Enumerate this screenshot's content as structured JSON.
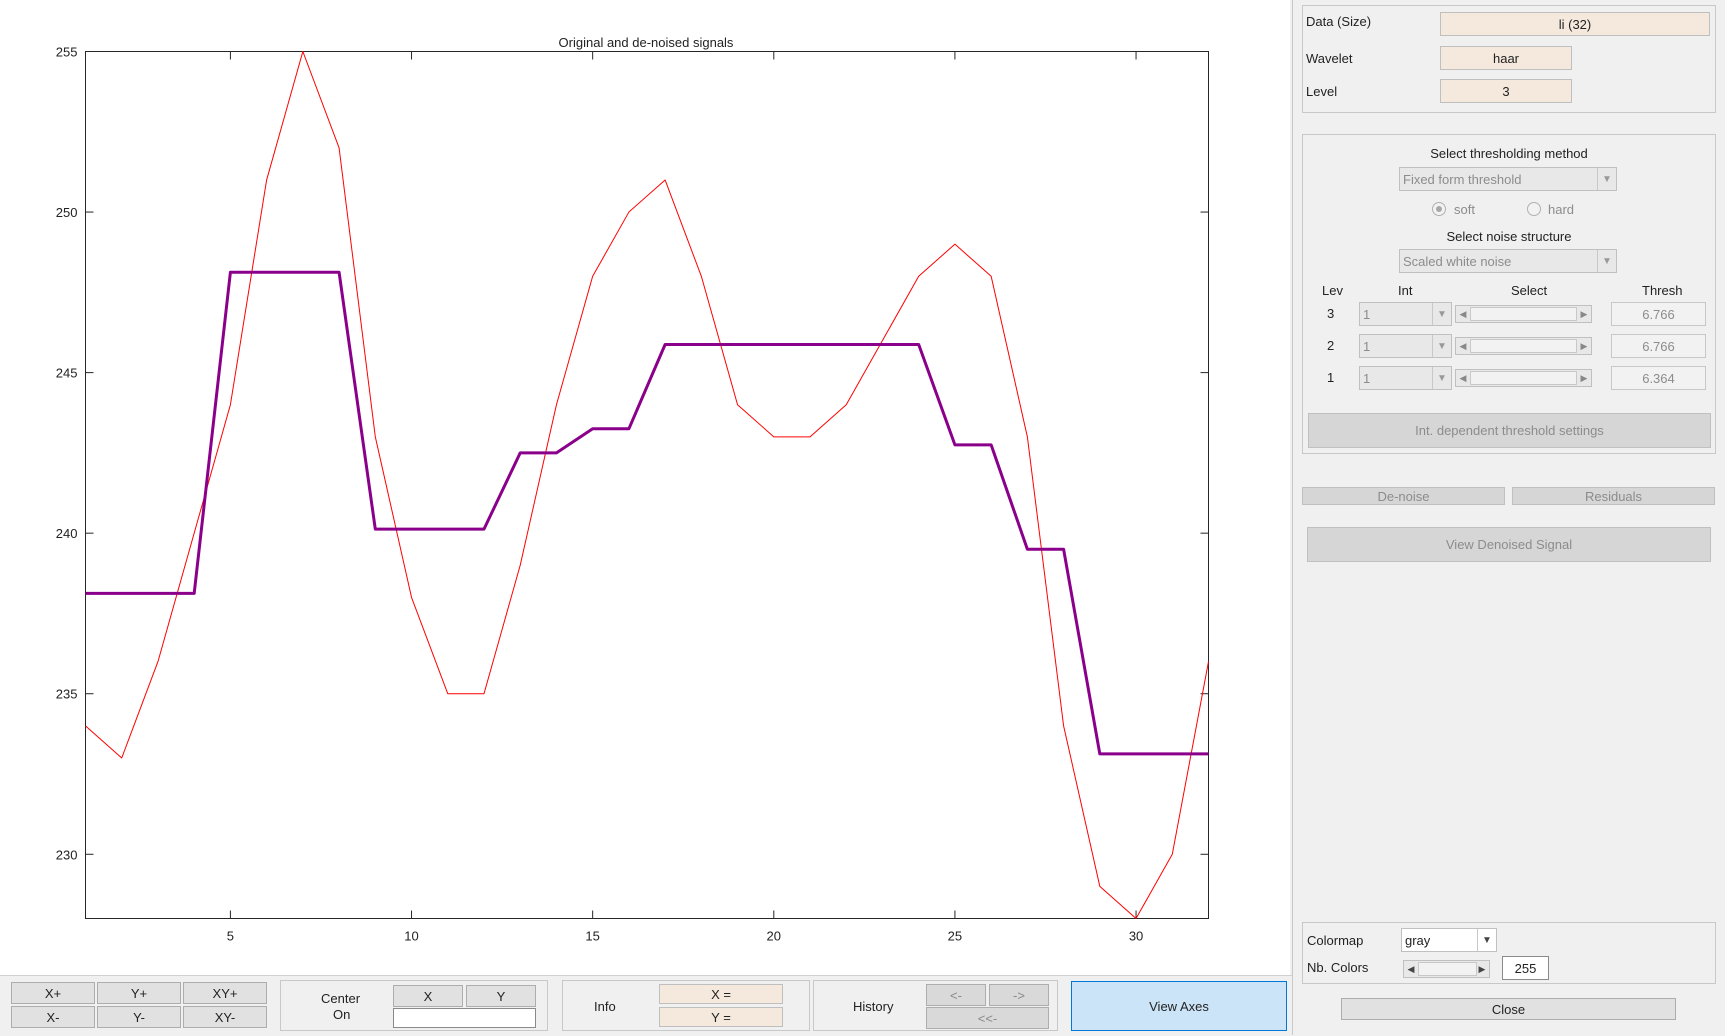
{
  "chart_data": {
    "type": "line",
    "title": "Original and de-noised signals",
    "xlabel": "",
    "ylabel": "",
    "xlim": [
      1,
      32
    ],
    "ylim": [
      228,
      255
    ],
    "x_ticks": [
      5,
      10,
      15,
      20,
      25,
      30
    ],
    "y_ticks": [
      230,
      235,
      240,
      245,
      250,
      255
    ],
    "grid": false,
    "legend": "none",
    "x": [
      1,
      2,
      3,
      4,
      5,
      6,
      7,
      8,
      9,
      10,
      11,
      12,
      13,
      14,
      15,
      16,
      17,
      18,
      19,
      20,
      21,
      22,
      23,
      24,
      25,
      26,
      27,
      28,
      29,
      30,
      31,
      32
    ],
    "series": [
      {
        "color": "#ff0000",
        "width": 1,
        "values": [
          234,
          233,
          236,
          240,
          244,
          251,
          255,
          252,
          243,
          238,
          235,
          235,
          239,
          244,
          248,
          250,
          251,
          248,
          244,
          243,
          243,
          244,
          246,
          248,
          249,
          248,
          243,
          234,
          229,
          228,
          230,
          236
        ]
      },
      {
        "color": "#8b008b",
        "width": 3,
        "step": true,
        "values": [
          238.125,
          238.125,
          238.125,
          238.125,
          248.125,
          248.125,
          248.125,
          248.125,
          240.125,
          240.125,
          240.125,
          240.125,
          242.5,
          242.5,
          243.25,
          243.25,
          245.875,
          245.875,
          245.875,
          245.875,
          245.875,
          245.875,
          245.875,
          245.875,
          242.75,
          242.75,
          239.5,
          239.5,
          233.125,
          233.125,
          233.125,
          233.125
        ]
      }
    ]
  },
  "right_panel": {
    "data_label": "Data  (Size)",
    "data_value": "li  (32)",
    "wavelet_label": "Wavelet",
    "wavelet_value": "haar",
    "level_label": "Level",
    "level_value": "3",
    "threshold_method_label": "Select thresholding method",
    "threshold_method": "Fixed form threshold",
    "soft_label": "soft",
    "hard_label": "hard",
    "noise_structure_label": "Select noise structure",
    "noise_structure": "Scaled white noise",
    "col_lev": "Lev",
    "col_int": "Int",
    "col_select": "Select",
    "col_thresh": "Thresh",
    "levels": [
      {
        "lev": "3",
        "int": "1",
        "thresh": "6.766"
      },
      {
        "lev": "2",
        "int": "1",
        "thresh": "6.766"
      },
      {
        "lev": "1",
        "int": "1",
        "thresh": "6.364"
      }
    ],
    "int_dependent_btn": "Int. dependent threshold settings",
    "denoise_btn": "De-noise",
    "residuals_btn": "Residuals",
    "view_denoised_btn": "View Denoised Signal",
    "colormap_label": "Colormap",
    "colormap_value": "gray",
    "nb_colors_label": "Nb. Colors",
    "nb_colors_value": "255",
    "close_btn": "Close"
  },
  "bottom_bar": {
    "zoom": {
      "x_plus": "X+",
      "y_plus": "Y+",
      "xy_plus": "XY+",
      "x_minus": "X-",
      "y_minus": "Y-",
      "xy_minus": "XY-"
    },
    "center_label_1": "Center",
    "center_label_2": "On",
    "center_x": "X",
    "center_y": "Y",
    "info_label": "Info",
    "info_x": "X =",
    "info_y": "Y =",
    "history_label": "History",
    "hist_back": "<-",
    "hist_fwd": "->",
    "hist_first": "<<-",
    "view_axes": "View Axes"
  }
}
